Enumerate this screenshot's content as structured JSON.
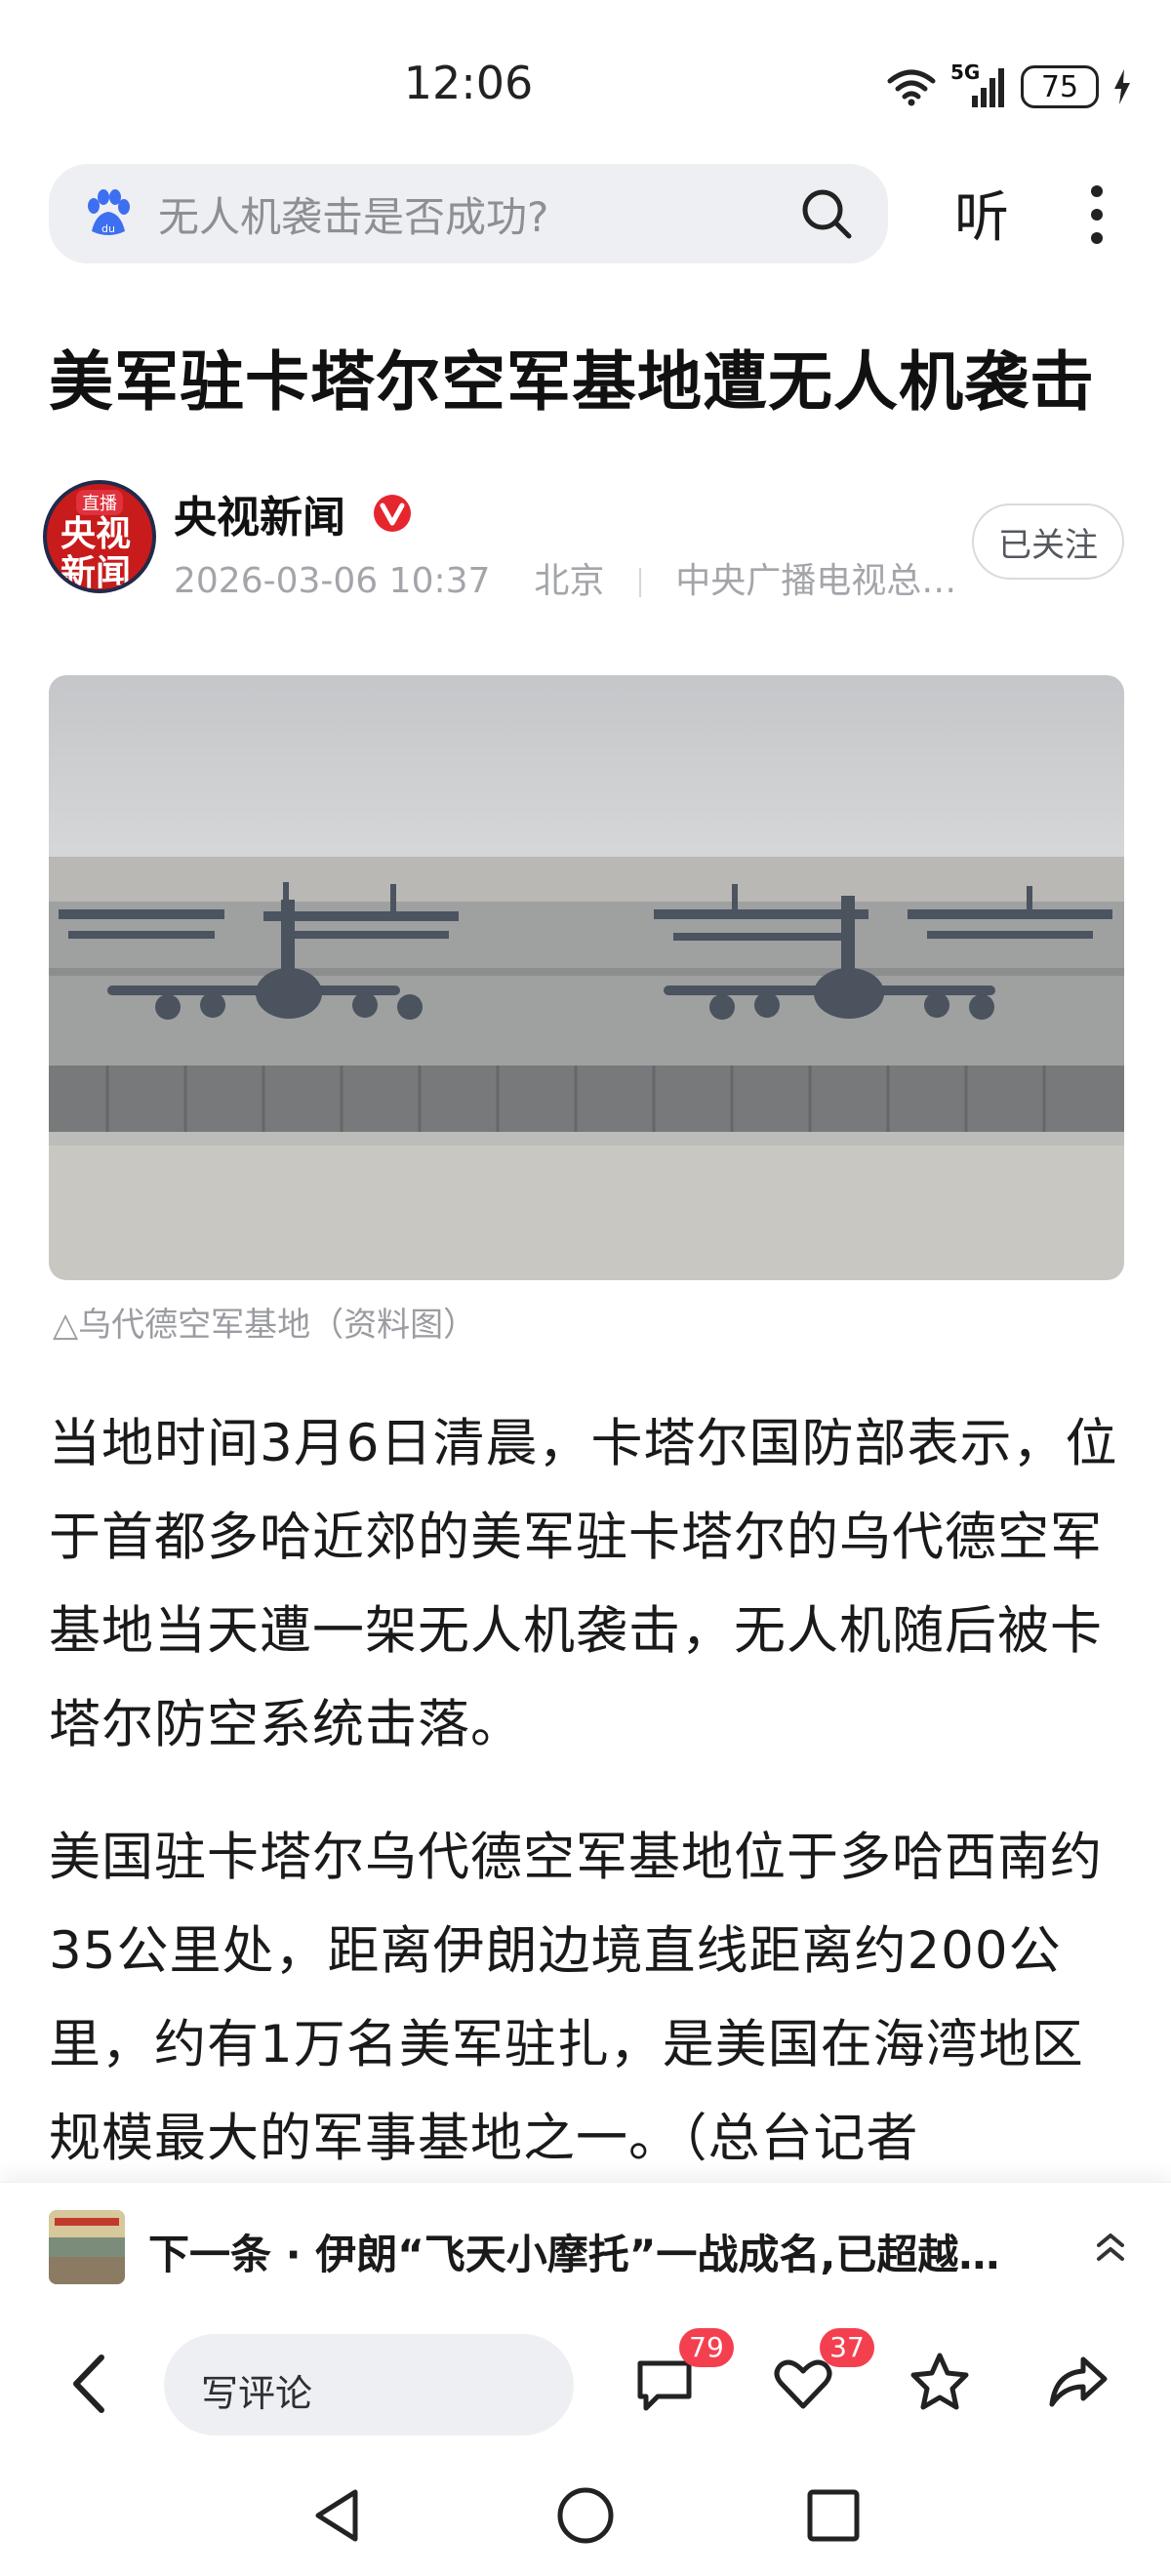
{
  "status_bar": {
    "time": "12:06",
    "network": "5G",
    "battery": "75"
  },
  "search": {
    "placeholder": "无人机袭击是否成功?"
  },
  "header": {
    "listen_label": "听"
  },
  "article": {
    "title": "美军驻卡塔尔空军基地遭无人机袭击",
    "author": {
      "name": "央视新闻",
      "avatar_live": "直播",
      "avatar_line1": "央视",
      "avatar_line2": "新闻"
    },
    "date": "2026-03-06 10:37",
    "location": "北京",
    "source": "中央广播电视总…",
    "follow_label": "已关注",
    "image_caption": "△乌代德空军基地（资料图）",
    "paragraphs": [
      "当地时间3月6日清晨，卡塔尔国防部表示，位于首都多哈近郊的美军驻卡塔尔的乌代德空军基地当天遭一架无人机袭击，无人机随后被卡塔尔防空系统击落。",
      "美国驻卡塔尔乌代德空军基地位于多哈西南约35公里处，距离伊朗边境直线距离约200公里，约有1万名美军驻扎，是美国在海湾地区规模最大的军事基地之一。（总台记者"
    ]
  },
  "next": {
    "label": "下一条 · 伊朗“飞天小摩托”一战成名,已超越…"
  },
  "toolbar": {
    "comment_placeholder": "写评论",
    "comment_count": "79",
    "like_count": "37"
  },
  "colors": {
    "accent_red": "#f43f4f",
    "verified_red": "#e5262f",
    "meta_gray": "#a3a5aa"
  }
}
